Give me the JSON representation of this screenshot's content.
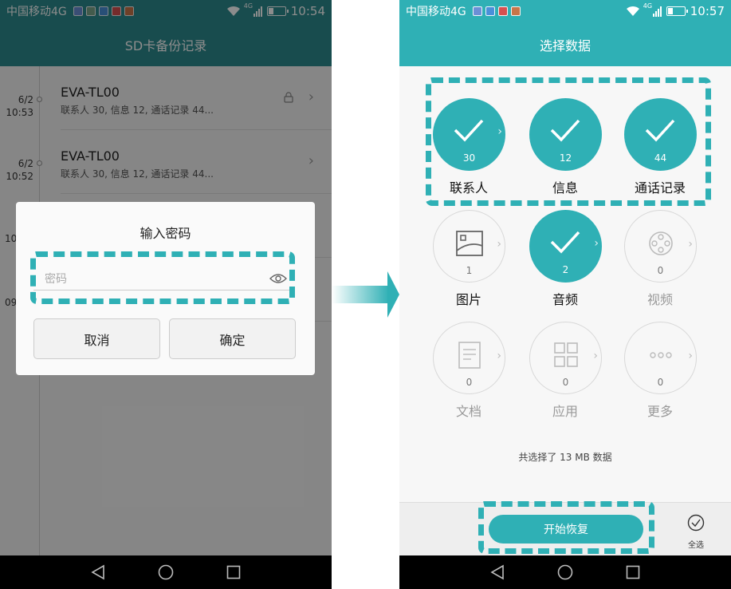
{
  "left_screen": {
    "status": {
      "carrier": "中国移动4G",
      "network": "4G",
      "time": "10:54"
    },
    "title": "SD卡备份记录",
    "rows": [
      {
        "date": "6/2",
        "time": "10:53",
        "name": "EVA-TL00",
        "detail": "联系人 30, 信息 12, 通话记录 44..."
      },
      {
        "date": "6/2",
        "time": "10:52",
        "name": "EVA-TL00",
        "detail": "联系人 30, 信息 12, 通话记录 44..."
      }
    ],
    "partial_dates": [
      "10",
      "09"
    ],
    "dialog": {
      "title": "输入密码",
      "password_placeholder": "密码",
      "cancel_label": "取消",
      "confirm_label": "确定"
    }
  },
  "right_screen": {
    "status": {
      "carrier": "中国移动4G",
      "network": "4G",
      "time": "10:57"
    },
    "title": "选择数据",
    "categories": [
      {
        "label": "联系人",
        "count": "30",
        "selected": true,
        "icon": "check-icon"
      },
      {
        "label": "信息",
        "count": "12",
        "selected": true,
        "icon": "check-icon"
      },
      {
        "label": "通话记录",
        "count": "44",
        "selected": true,
        "icon": "check-icon"
      },
      {
        "label": "图片",
        "count": "1",
        "selected": false,
        "icon": "image-icon"
      },
      {
        "label": "音频",
        "count": "2",
        "selected": true,
        "icon": "check-icon"
      },
      {
        "label": "视频",
        "count": "0",
        "selected": false,
        "icon": "film-reel-icon"
      },
      {
        "label": "文档",
        "count": "0",
        "selected": false,
        "icon": "document-icon"
      },
      {
        "label": "应用",
        "count": "0",
        "selected": false,
        "icon": "app-grid-icon"
      },
      {
        "label": "更多",
        "count": "0",
        "selected": false,
        "icon": "more-dots-icon"
      }
    ],
    "summary": "共选择了 13 MB 数据",
    "start_label": "开始恢复",
    "select_all_label": "全选"
  },
  "colors": {
    "accent": "#2fb0b5",
    "accent_dark": "#2d8a8e",
    "highlight": "#2fb0b5"
  }
}
